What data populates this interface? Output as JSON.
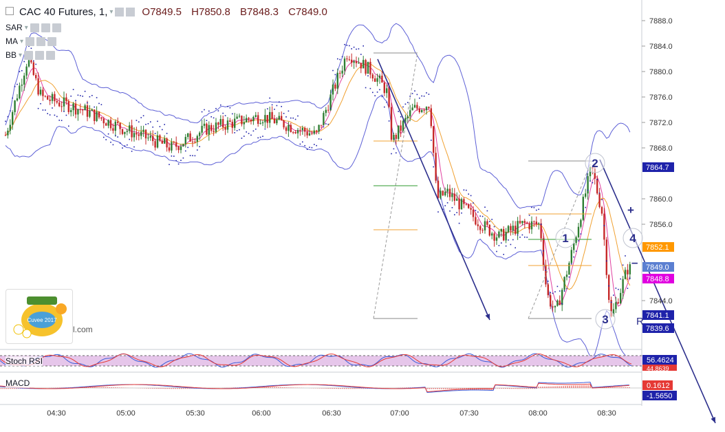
{
  "header": {
    "symbol": "CAC 40 Futures, 1,",
    "open": "O7849.5",
    "high": "H7850.8",
    "bid": "B7848.3",
    "close": "C7849.0"
  },
  "indicators": [
    {
      "label": "SAR"
    },
    {
      "label": "MA"
    },
    {
      "label": "BB"
    }
  ],
  "price_axis": {
    "ticks": [
      "7888.0",
      "7884.0",
      "7880.0",
      "7876.0",
      "7872.0",
      "7868.0",
      "7860.0",
      "7856.0",
      "7844.0"
    ],
    "tags": [
      {
        "label": "7864.7",
        "color": "#1e22aa"
      },
      {
        "label": "7852.1",
        "color": "#ff9800"
      },
      {
        "label": "7849.0",
        "color": "#5b7fd1"
      },
      {
        "label": "7848.8",
        "color": "#e000e0"
      },
      {
        "label": "7841.1",
        "color": "#1e22aa"
      },
      {
        "label": "7839.6",
        "color": "#1e22aa"
      }
    ]
  },
  "time_axis": {
    "labels": [
      "04:30",
      "05:00",
      "05:30",
      "06:00",
      "06:30",
      "07:00",
      "07:30",
      "08:00",
      "08:30"
    ]
  },
  "panes": {
    "stoch_rsi": {
      "label": "Stoch RSI",
      "value1": "56.4624",
      "value2": "44.8639"
    },
    "macd": {
      "label": "MACD",
      "value1": "0.1612",
      "value2": "-1.5650"
    }
  },
  "annotations": {
    "wave_labels": [
      "1",
      "2",
      "3",
      "4"
    ],
    "plus": "+",
    "minus": "–",
    "r_label": "R"
  },
  "logo": {
    "badge": "Cuvee 2017",
    "tail": "l.com"
  },
  "colors": {
    "up": "#2e7d32",
    "down": "#c62828",
    "bb": "#5c5fd6",
    "sar": "#1e22aa",
    "ma_fast": "#e040a0",
    "ma_slow": "#f0a030",
    "arrow": "#2c2f8c",
    "stoch_fill": "#e6c6ea"
  }
}
